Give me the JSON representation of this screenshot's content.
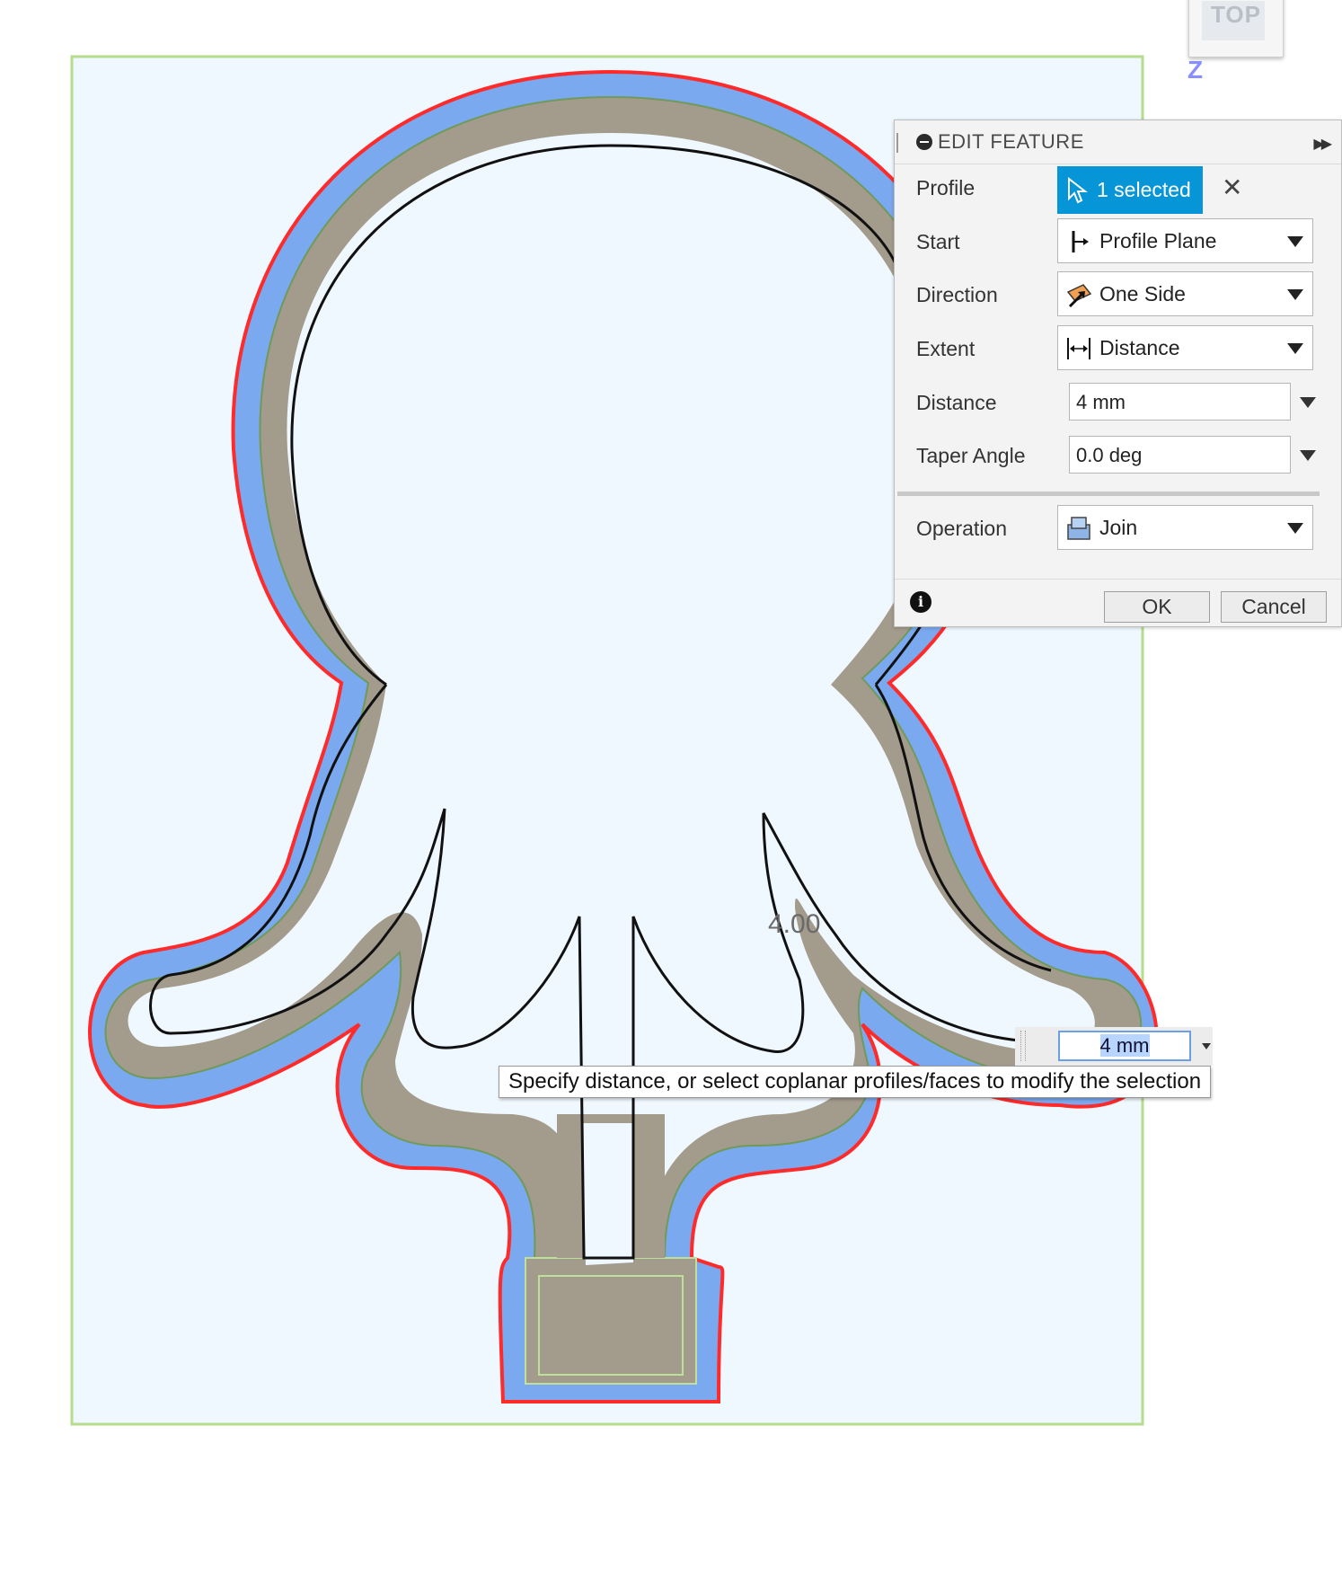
{
  "viewcube": {
    "face_label": "TOP",
    "axis_label": "Z"
  },
  "panel": {
    "title": "EDIT FEATURE",
    "rows": {
      "profile": {
        "label": "Profile",
        "value": "1 selected"
      },
      "start": {
        "label": "Start",
        "value": "Profile Plane"
      },
      "direction": {
        "label": "Direction",
        "value": "One Side"
      },
      "extent": {
        "label": "Extent",
        "value": "Distance"
      },
      "distance": {
        "label": "Distance",
        "value": "4 mm"
      },
      "taper": {
        "label": "Taper Angle",
        "value": "0.0 deg"
      },
      "operation": {
        "label": "Operation",
        "value": "Join"
      }
    },
    "buttons": {
      "ok": "OK",
      "cancel": "Cancel"
    }
  },
  "canvas": {
    "dimension_label": "4.00",
    "distance_input": "4 mm",
    "tooltip": "Specify distance, or select coplanar profiles/faces to modify the selection"
  },
  "colors": {
    "sketch_plane": "#f0f8ff",
    "plane_border": "#b6dc8c",
    "offset_blue": "#7aa9ef",
    "edge_red": "#ff2a2a",
    "body_taupe": "#a39b8c",
    "accent": "#0696d7"
  }
}
